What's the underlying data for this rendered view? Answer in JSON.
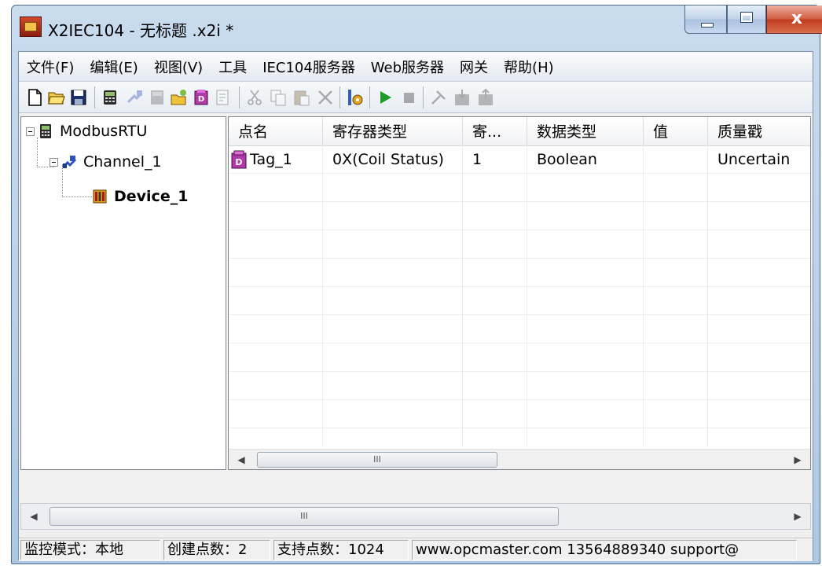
{
  "window": {
    "title": "X2IEC104 - 无标题 .x2i *"
  },
  "menu": [
    "文件(F)",
    "编辑(E)",
    "视图(V)",
    "工具",
    "IEC104服务器",
    "Web服务器",
    "网关",
    "帮助(H)"
  ],
  "toolbar": {
    "buttons": [
      {
        "icon": "new-file-icon",
        "enabled": true
      },
      {
        "icon": "open-folder-icon",
        "enabled": true
      },
      {
        "icon": "save-icon",
        "enabled": true
      },
      {
        "icon": "add-device-icon",
        "enabled": true
      },
      {
        "icon": "add-channel-icon",
        "enabled": false
      },
      {
        "icon": "add-device-disabled-icon",
        "enabled": false
      },
      {
        "icon": "new-tag-icon",
        "enabled": true
      },
      {
        "icon": "tag-icon",
        "enabled": true
      },
      {
        "icon": "properties-icon",
        "enabled": false
      },
      {
        "icon": "cut-icon",
        "enabled": false
      },
      {
        "icon": "copy-icon",
        "enabled": false
      },
      {
        "icon": "paste-icon",
        "enabled": false
      },
      {
        "icon": "delete-icon",
        "enabled": false
      },
      {
        "icon": "runtime-settings-icon",
        "enabled": true
      },
      {
        "icon": "start-icon",
        "enabled": true
      },
      {
        "icon": "stop-icon",
        "enabled": false
      },
      {
        "icon": "tools-icon",
        "enabled": false
      },
      {
        "icon": "load-icon",
        "enabled": false
      },
      {
        "icon": "upload-icon",
        "enabled": false
      }
    ]
  },
  "tree": {
    "root": "ModbusRTU",
    "channel": "Channel_1",
    "device": "Device_1"
  },
  "table": {
    "columns": [
      "点名",
      "寄存器类型",
      "寄...",
      "数据类型",
      "值",
      "质量戳"
    ],
    "rows": [
      {
        "name": "Tag_1",
        "register_type": "0X(Coil Status)",
        "address": "1",
        "data_type": "Boolean",
        "value": "",
        "quality": "Uncertain"
      }
    ],
    "scroll_grip": "III"
  },
  "main_scroll_grip": "III",
  "status": {
    "mode": "监控模式：本地",
    "created": "创建点数：2",
    "supported": "支持点数：1024",
    "contact": "www.opcmaster.com 13564889340 support@"
  },
  "colors": {
    "title_bar": "#c9dcee",
    "start_green": "#1e9a2a",
    "close_red": "#c03a1c"
  }
}
